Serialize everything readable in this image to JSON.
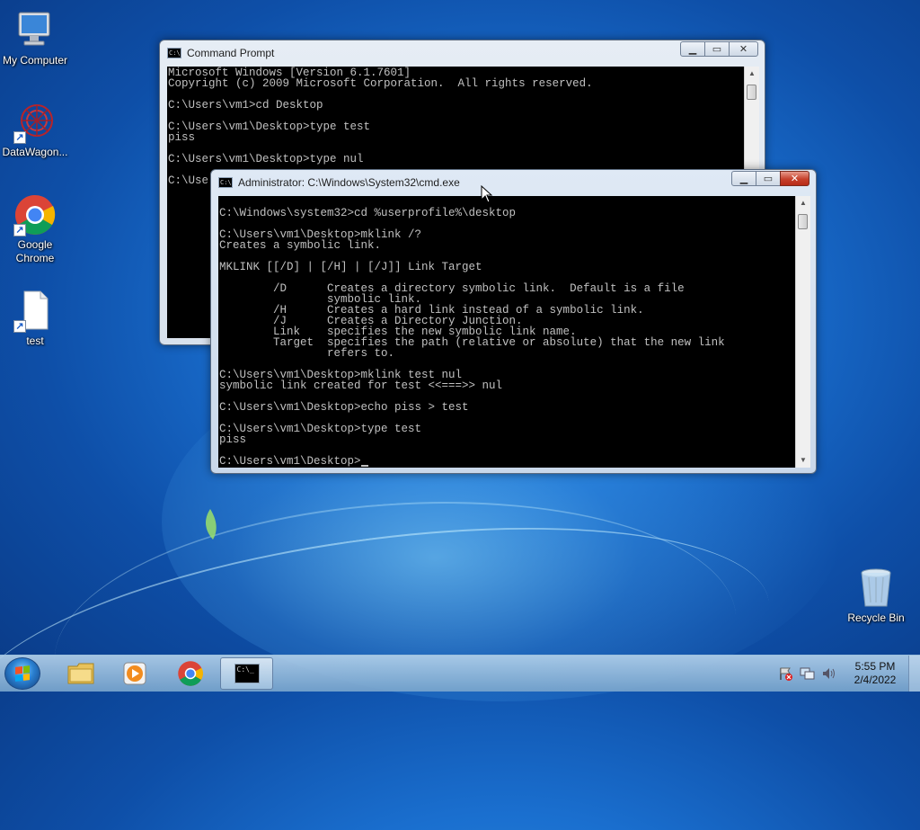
{
  "desktop": {
    "icons": [
      {
        "label": "My Computer"
      },
      {
        "label": "DataWagon..."
      },
      {
        "label": "Google Chrome"
      },
      {
        "label": "test"
      },
      {
        "label": "Recycle Bin"
      }
    ]
  },
  "windows": {
    "back": {
      "title": "Command Prompt",
      "lines": [
        "Microsoft Windows [Version 6.1.7601]",
        "Copyright (c) 2009 Microsoft Corporation.  All rights reserved.",
        "",
        "C:\\Users\\vm1>cd Desktop",
        "",
        "C:\\Users\\vm1\\Desktop>type test",
        "piss",
        "",
        "C:\\Users\\vm1\\Desktop>type nul",
        "",
        "C:\\Use"
      ]
    },
    "front": {
      "title": "Administrator: C:\\Windows\\System32\\cmd.exe",
      "lines": [
        "",
        "C:\\Windows\\system32>cd %userprofile%\\desktop",
        "",
        "C:\\Users\\vm1\\Desktop>mklink /?",
        "Creates a symbolic link.",
        "",
        "MKLINK [[/D] | [/H] | [/J]] Link Target",
        "",
        "        /D      Creates a directory symbolic link.  Default is a file",
        "                symbolic link.",
        "        /H      Creates a hard link instead of a symbolic link.",
        "        /J      Creates a Directory Junction.",
        "        Link    specifies the new symbolic link name.",
        "        Target  specifies the path (relative or absolute) that the new link",
        "                refers to.",
        "",
        "C:\\Users\\vm1\\Desktop>mklink test nul",
        "symbolic link created for test <<===>> nul",
        "",
        "C:\\Users\\vm1\\Desktop>echo piss > test",
        "",
        "C:\\Users\\vm1\\Desktop>type test",
        "piss",
        ""
      ],
      "prompt": "C:\\Users\\vm1\\Desktop>"
    }
  },
  "taskbar": {
    "time": "5:55 PM",
    "date": "2/4/2022"
  },
  "colors": {
    "console_bg": "#000000",
    "console_fg": "#c0c0c0",
    "close_active": "#c6402b"
  }
}
